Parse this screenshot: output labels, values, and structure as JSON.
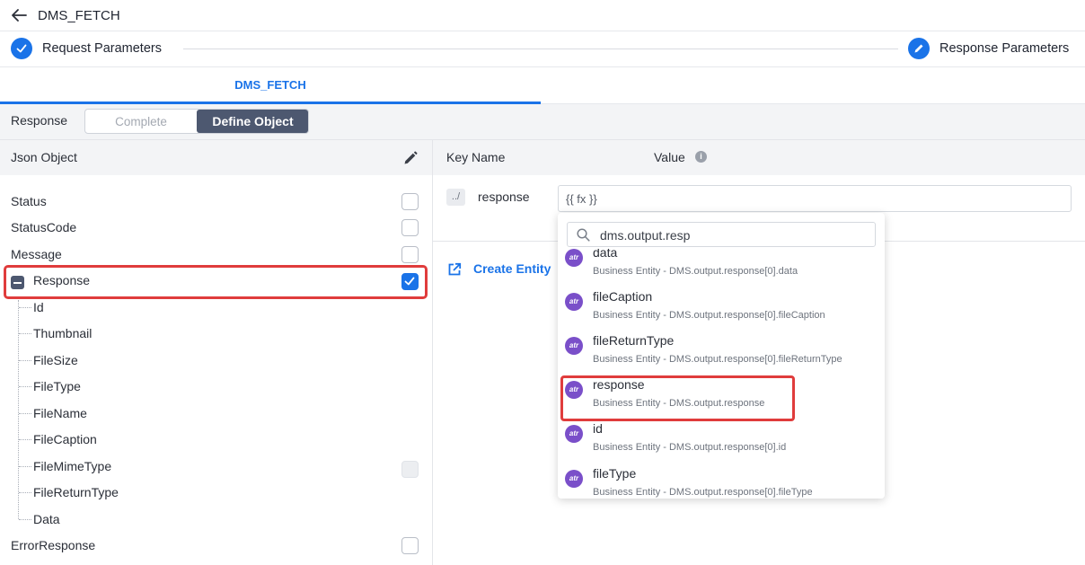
{
  "header": {
    "title": "DMS_FETCH"
  },
  "stepper": {
    "step1": "Request Parameters",
    "step2": "Response Parameters"
  },
  "tabs": [
    {
      "label": "DMS_FETCH",
      "active": true
    }
  ],
  "response_bar": {
    "label": "Response",
    "options": [
      "Complete",
      "Define Object"
    ],
    "selected": "Define Object"
  },
  "left_panel": {
    "title": "Json Object",
    "items": [
      {
        "label": "Status",
        "checked": false
      },
      {
        "label": "StatusCode",
        "checked": false
      },
      {
        "label": "Message",
        "checked": false
      },
      {
        "label": "Response",
        "checked": true,
        "expanded": true
      },
      {
        "label": "ErrorResponse",
        "checked": false
      }
    ],
    "children": [
      "Id",
      "Thumbnail",
      "FileSize",
      "FileType",
      "FileName",
      "FileCaption",
      "FileMimeType",
      "FileReturnType",
      "Data"
    ]
  },
  "right_panel": {
    "key_name_header": "Key Name",
    "value_header": "Value",
    "info_glyph": "i",
    "path_button": "../",
    "key_name": "response",
    "value": "{{ fx }}",
    "create_entity": "Create Entity"
  },
  "dropdown": {
    "search_value": "dms.output.resp",
    "items": [
      {
        "name": "data",
        "sub": "Business Entity - DMS.output.response[0].data"
      },
      {
        "name": "fileCaption",
        "sub": "Business Entity - DMS.output.response[0].fileCaption"
      },
      {
        "name": "fileReturnType",
        "sub": "Business Entity - DMS.output.response[0].fileReturnType"
      },
      {
        "name": "response",
        "sub": "Business Entity - DMS.output.response"
      },
      {
        "name": "id",
        "sub": "Business Entity - DMS.output.response[0].id"
      },
      {
        "name": "fileType",
        "sub": "Business Entity - DMS.output.response[0].fileType"
      }
    ],
    "icon_text": "atr"
  },
  "colors": {
    "accent": "#1a73e8",
    "highlight": "#e03c3c",
    "attr_icon": "#7a4fc9",
    "segment_dark": "#4d5870"
  }
}
